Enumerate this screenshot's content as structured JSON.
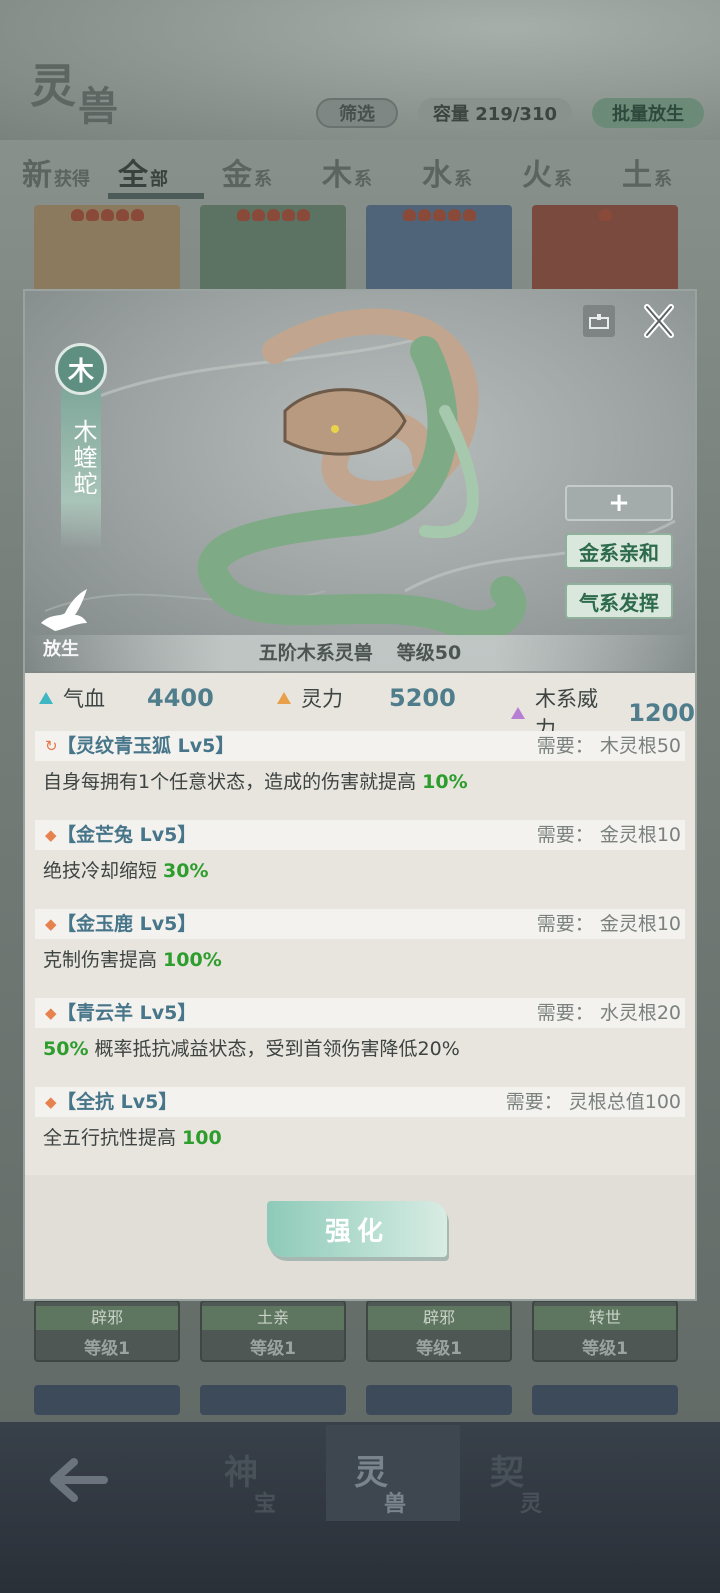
{
  "header": {
    "title_char1": "灵",
    "title_char2": "兽",
    "filter_label": "筛选",
    "capacity_label": "容量 219/310",
    "batch_release_label": "批量放生"
  },
  "tabs": [
    {
      "big": "新",
      "small": "获得"
    },
    {
      "big": "全",
      "small": "部"
    },
    {
      "big": "金",
      "small": "系"
    },
    {
      "big": "木",
      "small": "系"
    },
    {
      "big": "水",
      "small": "系"
    },
    {
      "big": "火",
      "small": "系"
    },
    {
      "big": "土",
      "small": "系"
    }
  ],
  "background_cards": [
    {
      "name": "辟邪",
      "level": "等级1"
    },
    {
      "name": "土亲",
      "level": "等级1"
    },
    {
      "name": "辟邪",
      "level": "等级1"
    },
    {
      "name": "转世",
      "level": "等级1"
    }
  ],
  "bottom_nav": [
    {
      "a": "神",
      "b": "宝"
    },
    {
      "a": "灵",
      "b": "兽"
    },
    {
      "a": "契",
      "b": "灵"
    }
  ],
  "beast": {
    "element": "木",
    "name": "木蝰蛇",
    "release_label": "放生",
    "caption_tier": "五阶木系灵兽",
    "caption_level": "等级50",
    "side_plus": "+",
    "affinity_1": "金系亲和",
    "affinity_2": "气系发挥"
  },
  "stats": [
    {
      "label": "气血",
      "value": "4400",
      "color": "#3fb6c4"
    },
    {
      "label": "灵力",
      "value": "5200",
      "color": "#e8a04a"
    },
    {
      "label": "木系威力",
      "value": "1200",
      "color": "#b77fd4"
    }
  ],
  "skills": [
    {
      "icon": "↻",
      "name": "【灵纹青玉狐 Lv5】",
      "req": "需要：  木灵根50",
      "desc": "自身每拥有1个任意状态，造成的伤害就提高 ",
      "highlight": "10%",
      "desc_after": ""
    },
    {
      "icon": "◆",
      "name": "【金芒兔 Lv5】",
      "req": "需要：  金灵根10",
      "desc": "绝技冷却缩短 ",
      "highlight": "30%",
      "desc_after": ""
    },
    {
      "icon": "◆",
      "name": "【金玉鹿 Lv5】",
      "req": "需要：  金灵根10",
      "desc": "克制伤害提高 ",
      "highlight": "100%",
      "desc_after": ""
    },
    {
      "icon": "◆",
      "name": "【青云羊 Lv5】",
      "req": "需要：  水灵根20",
      "desc": "",
      "highlight": "50%",
      "desc_after": " 概率抵抗减益状态，受到首领伤害降低20%"
    },
    {
      "icon": "◆",
      "name": "【全抗 Lv5】",
      "req": "需要：  灵根总值100",
      "desc": "全五行抗性提高 ",
      "highlight": "100",
      "desc_after": ""
    }
  ],
  "strengthen_label": "强化"
}
